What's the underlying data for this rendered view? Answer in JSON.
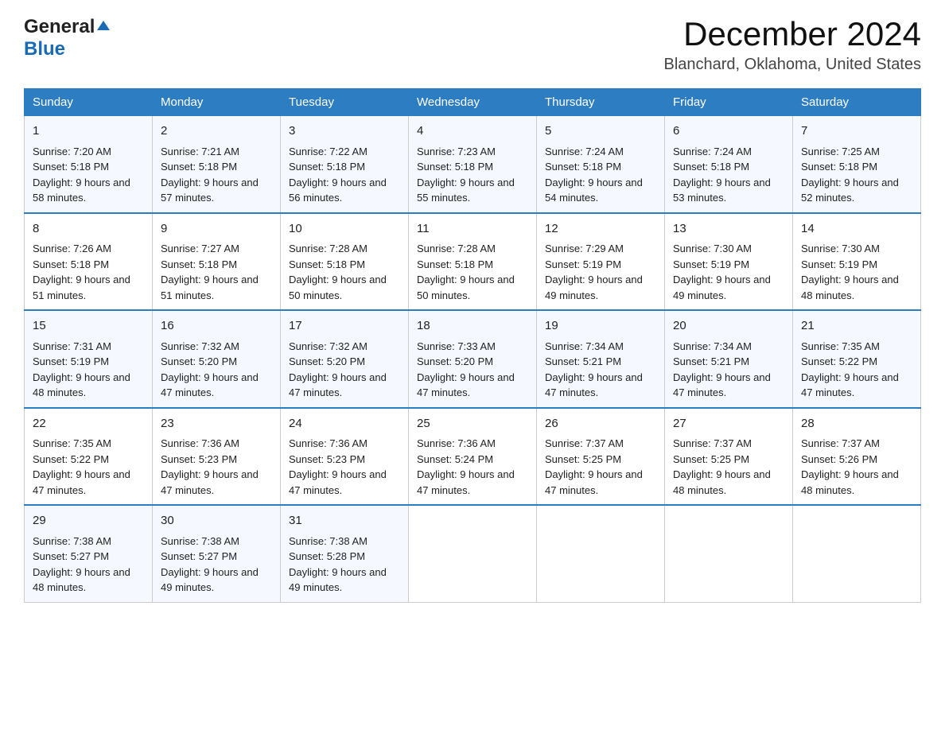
{
  "logo": {
    "general": "General",
    "triangle": "",
    "blue": "Blue"
  },
  "title": "December 2024",
  "subtitle": "Blanchard, Oklahoma, United States",
  "days_of_week": [
    "Sunday",
    "Monday",
    "Tuesday",
    "Wednesday",
    "Thursday",
    "Friday",
    "Saturday"
  ],
  "weeks": [
    [
      {
        "day": "1",
        "sunrise": "7:20 AM",
        "sunset": "5:18 PM",
        "daylight": "9 hours and 58 minutes."
      },
      {
        "day": "2",
        "sunrise": "7:21 AM",
        "sunset": "5:18 PM",
        "daylight": "9 hours and 57 minutes."
      },
      {
        "day": "3",
        "sunrise": "7:22 AM",
        "sunset": "5:18 PM",
        "daylight": "9 hours and 56 minutes."
      },
      {
        "day": "4",
        "sunrise": "7:23 AM",
        "sunset": "5:18 PM",
        "daylight": "9 hours and 55 minutes."
      },
      {
        "day": "5",
        "sunrise": "7:24 AM",
        "sunset": "5:18 PM",
        "daylight": "9 hours and 54 minutes."
      },
      {
        "day": "6",
        "sunrise": "7:24 AM",
        "sunset": "5:18 PM",
        "daylight": "9 hours and 53 minutes."
      },
      {
        "day": "7",
        "sunrise": "7:25 AM",
        "sunset": "5:18 PM",
        "daylight": "9 hours and 52 minutes."
      }
    ],
    [
      {
        "day": "8",
        "sunrise": "7:26 AM",
        "sunset": "5:18 PM",
        "daylight": "9 hours and 51 minutes."
      },
      {
        "day": "9",
        "sunrise": "7:27 AM",
        "sunset": "5:18 PM",
        "daylight": "9 hours and 51 minutes."
      },
      {
        "day": "10",
        "sunrise": "7:28 AM",
        "sunset": "5:18 PM",
        "daylight": "9 hours and 50 minutes."
      },
      {
        "day": "11",
        "sunrise": "7:28 AM",
        "sunset": "5:18 PM",
        "daylight": "9 hours and 50 minutes."
      },
      {
        "day": "12",
        "sunrise": "7:29 AM",
        "sunset": "5:19 PM",
        "daylight": "9 hours and 49 minutes."
      },
      {
        "day": "13",
        "sunrise": "7:30 AM",
        "sunset": "5:19 PM",
        "daylight": "9 hours and 49 minutes."
      },
      {
        "day": "14",
        "sunrise": "7:30 AM",
        "sunset": "5:19 PM",
        "daylight": "9 hours and 48 minutes."
      }
    ],
    [
      {
        "day": "15",
        "sunrise": "7:31 AM",
        "sunset": "5:19 PM",
        "daylight": "9 hours and 48 minutes."
      },
      {
        "day": "16",
        "sunrise": "7:32 AM",
        "sunset": "5:20 PM",
        "daylight": "9 hours and 47 minutes."
      },
      {
        "day": "17",
        "sunrise": "7:32 AM",
        "sunset": "5:20 PM",
        "daylight": "9 hours and 47 minutes."
      },
      {
        "day": "18",
        "sunrise": "7:33 AM",
        "sunset": "5:20 PM",
        "daylight": "9 hours and 47 minutes."
      },
      {
        "day": "19",
        "sunrise": "7:34 AM",
        "sunset": "5:21 PM",
        "daylight": "9 hours and 47 minutes."
      },
      {
        "day": "20",
        "sunrise": "7:34 AM",
        "sunset": "5:21 PM",
        "daylight": "9 hours and 47 minutes."
      },
      {
        "day": "21",
        "sunrise": "7:35 AM",
        "sunset": "5:22 PM",
        "daylight": "9 hours and 47 minutes."
      }
    ],
    [
      {
        "day": "22",
        "sunrise": "7:35 AM",
        "sunset": "5:22 PM",
        "daylight": "9 hours and 47 minutes."
      },
      {
        "day": "23",
        "sunrise": "7:36 AM",
        "sunset": "5:23 PM",
        "daylight": "9 hours and 47 minutes."
      },
      {
        "day": "24",
        "sunrise": "7:36 AM",
        "sunset": "5:23 PM",
        "daylight": "9 hours and 47 minutes."
      },
      {
        "day": "25",
        "sunrise": "7:36 AM",
        "sunset": "5:24 PM",
        "daylight": "9 hours and 47 minutes."
      },
      {
        "day": "26",
        "sunrise": "7:37 AM",
        "sunset": "5:25 PM",
        "daylight": "9 hours and 47 minutes."
      },
      {
        "day": "27",
        "sunrise": "7:37 AM",
        "sunset": "5:25 PM",
        "daylight": "9 hours and 48 minutes."
      },
      {
        "day": "28",
        "sunrise": "7:37 AM",
        "sunset": "5:26 PM",
        "daylight": "9 hours and 48 minutes."
      }
    ],
    [
      {
        "day": "29",
        "sunrise": "7:38 AM",
        "sunset": "5:27 PM",
        "daylight": "9 hours and 48 minutes."
      },
      {
        "day": "30",
        "sunrise": "7:38 AM",
        "sunset": "5:27 PM",
        "daylight": "9 hours and 49 minutes."
      },
      {
        "day": "31",
        "sunrise": "7:38 AM",
        "sunset": "5:28 PM",
        "daylight": "9 hours and 49 minutes."
      },
      null,
      null,
      null,
      null
    ]
  ],
  "colors": {
    "header_bg": "#2d7dc3",
    "header_text": "#ffffff",
    "accent_blue": "#1a6bb5"
  }
}
